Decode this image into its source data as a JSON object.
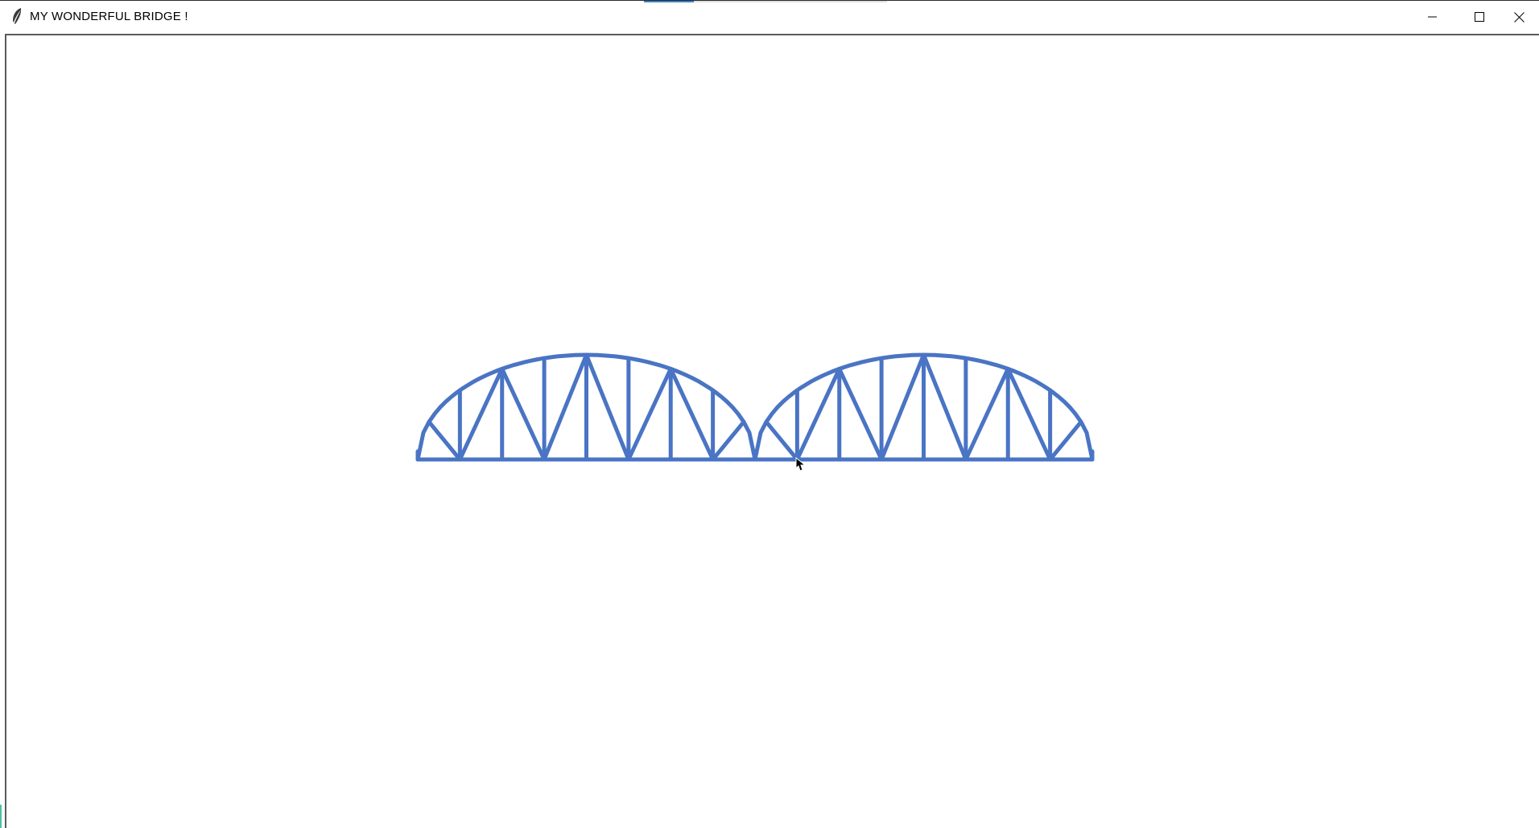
{
  "window": {
    "title": "MY WONDERFUL BRIDGE !",
    "app_icon": "feather-icon",
    "controls": {
      "minimize_icon": "minimize-icon",
      "maximize_icon": "maximize-icon",
      "close_icon": "close-icon"
    }
  },
  "colors": {
    "bridge_stroke": "#4a74c4",
    "titlebar_accent": "#3b83c6",
    "canvas_bg": "#ffffff"
  },
  "canvas": {
    "cursor_icon": "mouse-pointer-icon"
  }
}
